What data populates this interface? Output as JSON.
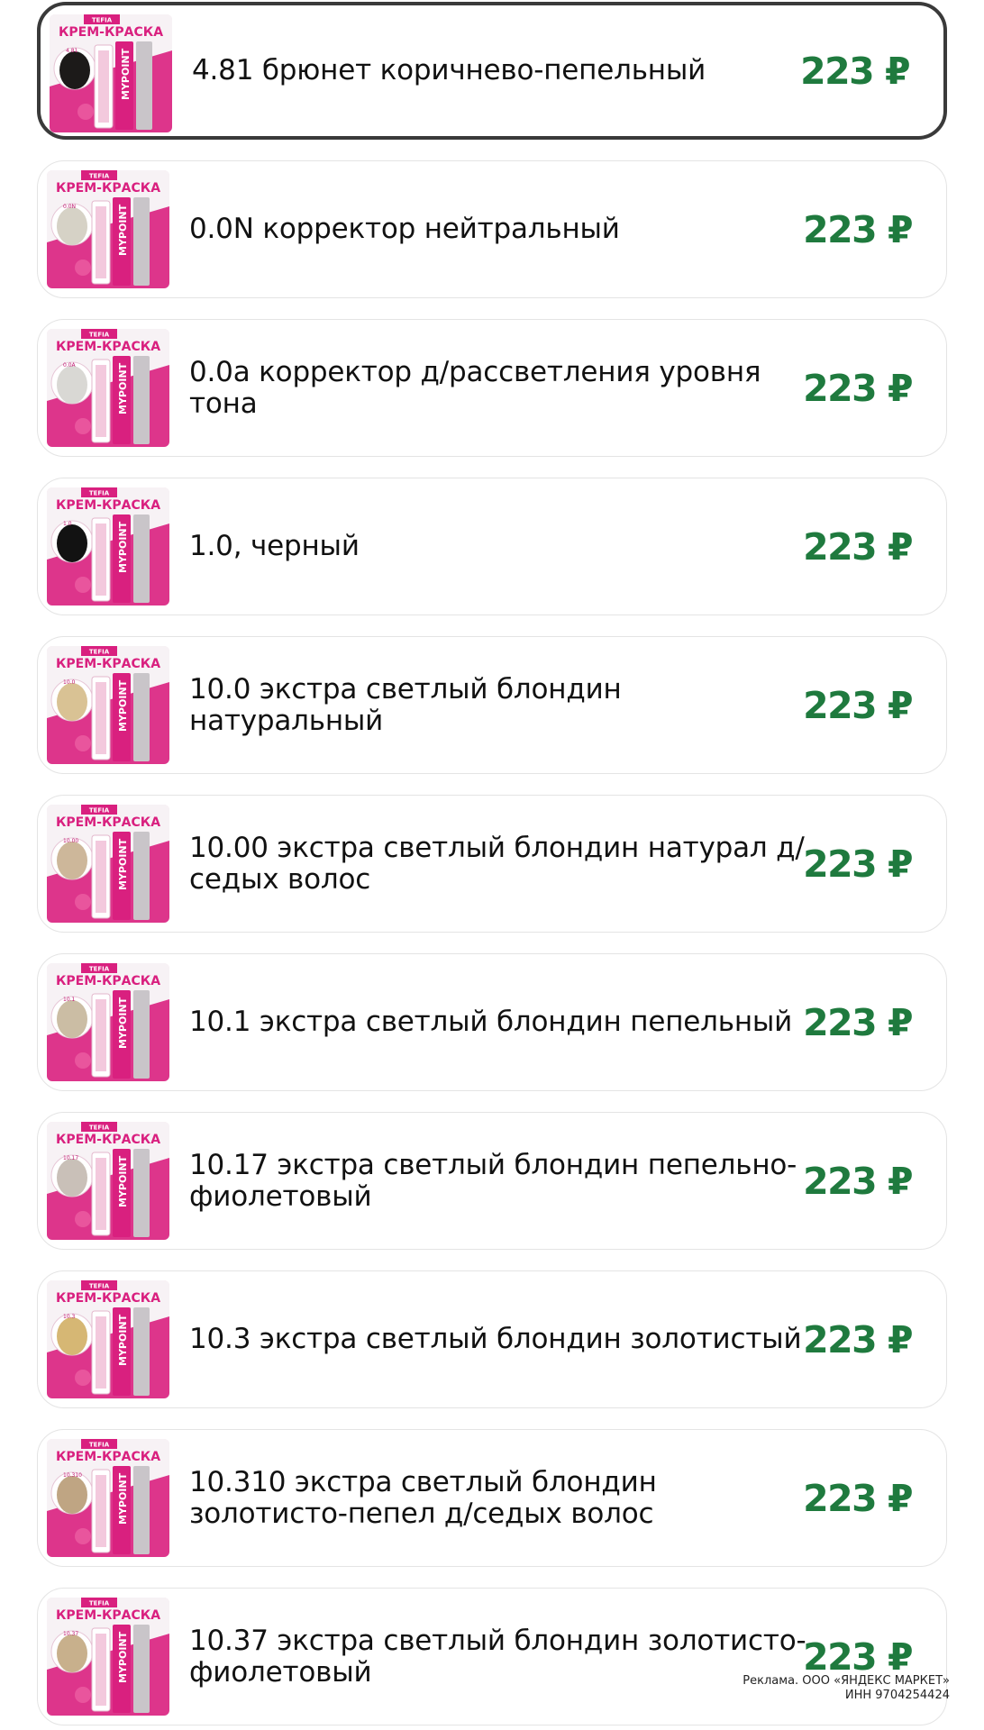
{
  "thumbnail_text": {
    "brand": "TEFIA",
    "headline": "КРЕМ-КРАСКА",
    "tube_label": "MYPOINT"
  },
  "products": [
    {
      "code": "4.81",
      "name": "4.81 брюнет коричнево-пепельный",
      "price": "223 ₽",
      "selected": true,
      "swatch": "#1c1a19"
    },
    {
      "code": "0.0N",
      "name": "0.0N корректор нейтральный",
      "price": "223 ₽",
      "selected": false,
      "swatch": "#d6d2c6"
    },
    {
      "code": "0.0A",
      "name": "0.0a корректор д/рассветления уровня тона",
      "price": "223 ₽",
      "selected": false,
      "swatch": "#d9d8d4"
    },
    {
      "code": "1.0",
      "name": "1.0, черный",
      "price": "223 ₽",
      "selected": false,
      "swatch": "#121212"
    },
    {
      "code": "10.0",
      "name": "10.0 экстра светлый блондин натуральный",
      "price": "223 ₽",
      "selected": false,
      "swatch": "#d9c294"
    },
    {
      "code": "10.00",
      "name": "10.00 экстра светлый блондин натурал д/ седых волос",
      "price": "223 ₽",
      "selected": false,
      "swatch": "#cdb79a"
    },
    {
      "code": "10.1",
      "name": "10.1 экстра светлый блондин пепельный",
      "price": "223 ₽",
      "selected": false,
      "swatch": "#cbbda4"
    },
    {
      "code": "10.17",
      "name": "10.17 экстра светлый блондин пепельно-фиолетовый",
      "price": "223 ₽",
      "selected": false,
      "swatch": "#c9c0b8"
    },
    {
      "code": "10.3",
      "name": "10.3 экстра светлый блондин золотистый",
      "price": "223 ₽",
      "selected": false,
      "swatch": "#d6b774"
    },
    {
      "code": "10.310",
      "name": "10.310 экстра светлый блондин золотисто-пепел д/седых волос",
      "price": "223 ₽",
      "selected": false,
      "swatch": "#bfa583"
    },
    {
      "code": "10.37",
      "name": "10.37 экстра светлый блондин золотисто-фиолетовый",
      "price": "223 ₽",
      "selected": false,
      "swatch": "#c8b08c"
    }
  ],
  "ad_notice": {
    "line1": "Реклама. ООО «ЯНДЕКС МАРКЕТ»",
    "line2": "ИНН 9704254424"
  },
  "colors": {
    "price_green": "#1f7a3e",
    "brand_pink": "#d9207f"
  }
}
